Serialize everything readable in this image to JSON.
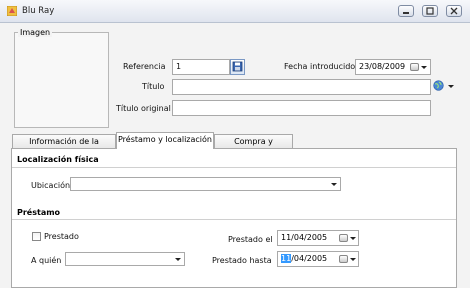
{
  "window": {
    "title": "Blu Ray"
  },
  "image_group": {
    "legend": "Imagen"
  },
  "fields": {
    "referencia_label": "Referencia",
    "referencia_value": "1",
    "fecha_label": "Fecha introducido",
    "fecha_value": "23/08/2009",
    "titulo_label": "Título",
    "titulo_value": "",
    "titulo_original_label": "Título original",
    "titulo_original_value": ""
  },
  "tabs": [
    {
      "label": "Información de la película",
      "active": false
    },
    {
      "label": "Préstamo y localización",
      "active": true
    },
    {
      "label": "Compra y producto",
      "active": false
    }
  ],
  "localizacion": {
    "title": "Localización física",
    "ubicacion_label": "Ubicación",
    "ubicacion_value": ""
  },
  "prestamo": {
    "title": "Préstamo",
    "prestado_label": "Prestado",
    "prestado_checked": false,
    "a_quien_label": "A quién",
    "a_quien_value": "",
    "prestado_el_label": "Prestado el",
    "prestado_el_value": "11/04/2005",
    "prestado_hasta_label": "Prestado hasta",
    "prestado_hasta_sel": "11",
    "prestado_hasta_rest": "/04/2005"
  },
  "colors": {
    "selection": "#3399ff",
    "titlebar": "#dfe4ee"
  }
}
